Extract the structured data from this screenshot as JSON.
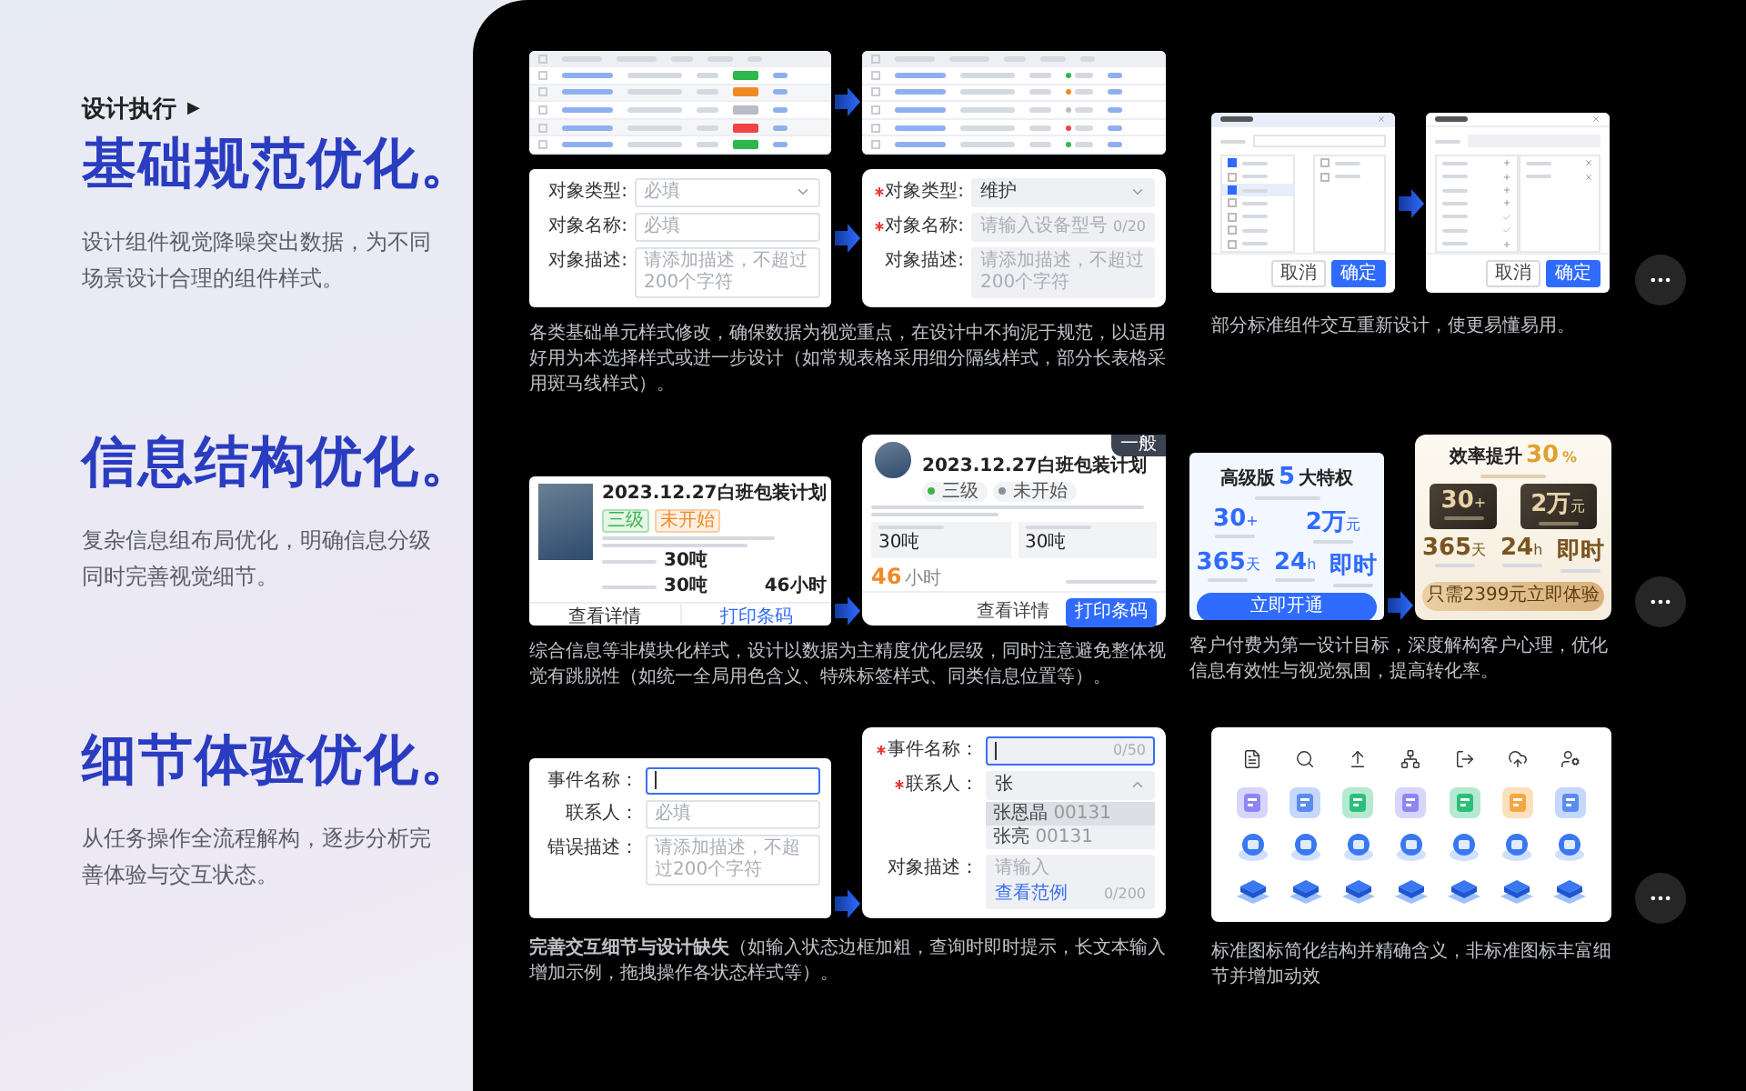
{
  "sidebar": {
    "breadcrumb": "设计执行",
    "breadcrumb_icon": "▶",
    "sections": [
      {
        "title": "基础规范优化。",
        "description": "设计组件视觉降噪突出数据，为不同场景设计合理的组件样式。"
      },
      {
        "title": "信息结构优化。",
        "description": "复杂信息组布局优化，明确信息分级同时完善视觉细节。"
      },
      {
        "title": "细节体验优化。",
        "description": "从任务操作全流程解构，逐步分析完善体验与交互状态。"
      }
    ]
  },
  "basics": {
    "tables": [
      {
        "kind": "tag",
        "rows": [
          {
            "color": "#2db84d"
          },
          {
            "color": "#f08a24"
          },
          {
            "color": "#b8bcc4"
          },
          {
            "color": "#ef4444"
          },
          {
            "color": "#2db84d"
          }
        ]
      },
      {
        "kind": "dot",
        "rows": [
          {
            "color": "#2db84d"
          },
          {
            "color": "#f08a24"
          },
          {
            "color": "#b8bcc4"
          },
          {
            "color": "#ef4444"
          },
          {
            "color": "#2db84d"
          }
        ]
      }
    ],
    "forms": [
      {
        "kind": "outlined",
        "fields": [
          {
            "label": "对象类型:",
            "kind": "select",
            "placeholder": "必填",
            "expanded": false
          },
          {
            "label": "对象名称:",
            "kind": "input",
            "placeholder": "必填"
          },
          {
            "label": "对象描述:",
            "kind": "textarea",
            "placeholder": "请添加描述，不超过200个字符"
          }
        ]
      },
      {
        "kind": "filled",
        "fields": [
          {
            "label": "对象类型:",
            "kind": "select",
            "value": "维护",
            "required": true,
            "expanded": false
          },
          {
            "label": "对象名称:",
            "kind": "input",
            "placeholder": "请输入设备型号",
            "counter": "0/20",
            "required": true
          },
          {
            "label": "对象描述:",
            "kind": "textarea",
            "placeholder": "请添加描述，不超过200个字符"
          }
        ]
      }
    ],
    "caption": "各类基础单元样式修改，确保数据为视觉重点，在设计中不拘泥于规范，以适用好用为本选择样式或进一步设计（如常规表格采用细分隔线样式，部分长表格采用斑马线样式）。"
  },
  "components": {
    "dialogs": [
      {
        "kind": "checklist",
        "left": [
          {
            "checked": true,
            "selected": false
          },
          {
            "checked": false,
            "selected": false
          },
          {
            "checked": true,
            "selected": true
          },
          {
            "checked": false,
            "selected": false
          },
          {
            "checked": false,
            "selected": false
          },
          {
            "checked": false,
            "selected": false
          },
          {
            "checked": false,
            "selected": false
          }
        ],
        "right": [
          {
            "checked": false,
            "selected": false
          },
          {
            "checked": false,
            "selected": false
          }
        ],
        "buttons": [
          "取消",
          "确定"
        ]
      },
      {
        "kind": "transfer",
        "left": [
          {
            "kind": "add"
          },
          {
            "kind": "add"
          },
          {
            "kind": "add"
          },
          {
            "kind": "add"
          },
          {
            "kind": "added"
          },
          {
            "kind": "added"
          },
          {
            "kind": "add"
          }
        ],
        "right": [
          {
            "kind": "remove"
          },
          {
            "kind": "remove"
          }
        ],
        "buttons": [
          "取消",
          "确定"
        ]
      }
    ],
    "caption": "部分标准组件交互重新设计，使更易懂易用。"
  },
  "info_cards": {
    "cards": [
      {
        "kind": "classic",
        "title": "2023.12.27白班包装计划",
        "tags": [
          {
            "label": "三级",
            "color": "#3bb54a"
          },
          {
            "label": "未开始",
            "color": "#f08a24"
          }
        ],
        "stats": [
          "30吨",
          "30吨"
        ],
        "duration": "46小时",
        "buttons": [
          {
            "label": "查看详情",
            "primary": false
          },
          {
            "label": "打印条码",
            "primary": false
          }
        ]
      },
      {
        "kind": "modern",
        "title": "2023.12.27白班包装计划",
        "badge": "一般",
        "tags": [
          {
            "label": "三级",
            "color": "#3bb54a"
          },
          {
            "label": "未开始",
            "color": "#8a8f99"
          }
        ],
        "stats": [
          "30吨",
          "30吨"
        ],
        "duration_value": "46",
        "duration_unit": "小时",
        "buttons": [
          {
            "label": "查看详情",
            "primary": false
          },
          {
            "label": "打印条码",
            "primary": true
          }
        ]
      }
    ],
    "caption": "综合信息等非模块化样式，设计以数据为主精度优化层级，同时注意避免整体视觉有跳脱性（如统一全局用色含义、特殊标签样式、同类信息位置等）。"
  },
  "pricing": {
    "plans": [
      {
        "kind": "standard",
        "title_prefix": "高级版",
        "highlight": "5",
        "title_suffix": "大特权",
        "stats": [
          {
            "value": "30",
            "unit": "+"
          },
          {
            "value": "2万",
            "unit": "元"
          },
          {
            "value": "365",
            "unit": "天"
          },
          {
            "value": "24",
            "unit": "h"
          },
          {
            "value": "即时"
          }
        ],
        "button": "立即开通"
      },
      {
        "kind": "premium",
        "title_prefix": "效率提升",
        "highlight": "30",
        "title_suffix": "%",
        "stats": [
          {
            "value": "30",
            "unit": "+"
          },
          {
            "value": "2万",
            "unit": "元"
          },
          {
            "value": "365",
            "unit": "天"
          },
          {
            "value": "24",
            "unit": "h"
          },
          {
            "value": "即时"
          }
        ],
        "button": "只需2399元立即体验"
      }
    ],
    "caption": "客户付费为第一设计目标，深度解构客户心理，优化信息有效性与视觉氛围，提高转化率。"
  },
  "inputs": {
    "forms": [
      {
        "kind": "outlined",
        "fields": [
          {
            "label": "事件名称：",
            "kind": "input",
            "focused": true
          },
          {
            "label": "联系人：",
            "kind": "input",
            "placeholder": "必填"
          },
          {
            "label": "错误描述：",
            "kind": "textarea",
            "placeholder": "请添加描述，不超过200个字符"
          }
        ]
      },
      {
        "kind": "filled",
        "fields": [
          {
            "label": "事件名称：",
            "kind": "input",
            "focused": true,
            "counter": "0/50",
            "required": true
          },
          {
            "label": "联系人：",
            "kind": "select",
            "value": "张",
            "required": true,
            "expanded": true,
            "options": [
              {
                "label": "张恩晶",
                "code": "00131",
                "selected": true
              },
              {
                "label": "张亮",
                "code": "00131",
                "selected": false
              }
            ]
          },
          {
            "label": "对象描述：",
            "kind": "textarea",
            "placeholder": "请输入",
            "link": "查看范例",
            "counter": "0/200"
          }
        ]
      }
    ],
    "caption": "**完善交互细节与设计缺失**（如输入状态边框加粗，查询时即时提示，长文本输入增加示例，拖拽操作各状态样式等）。"
  },
  "icons": {
    "caption": "标准图标简化结构并精确含义，非标准图标丰富细节并增加动效"
  }
}
